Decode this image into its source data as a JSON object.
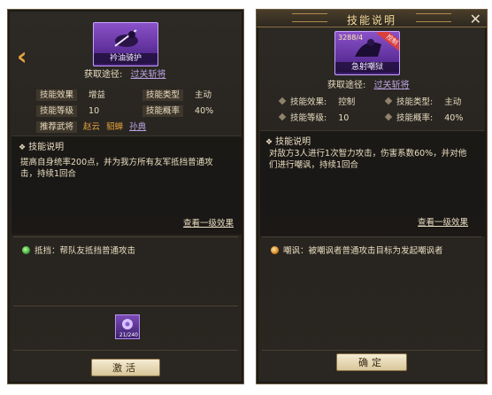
{
  "left": {
    "skill_card": {
      "name": "衿油骑护"
    },
    "source_label": "获取途径:",
    "source_link": "过关斩将",
    "attrs": {
      "effect_label": "技能效果",
      "effect_value": "增益",
      "type_label": "技能类型",
      "type_value": "主动",
      "level_label": "技能等级",
      "level_value": "10",
      "rate_label": "技能概率",
      "rate_value": "40%",
      "rec_label": "推荐武将",
      "rec_names": [
        "赵云",
        "貂蝉",
        "孙典"
      ]
    },
    "desc": {
      "head": "技能说明",
      "text": "提高自身统率200点，并为我方所有友军抵挡普通攻击，持续1回合",
      "more": "查看一级效果"
    },
    "effect": "抵挡：帮队友抵挡普通攻击",
    "item_qty": "21/240",
    "button": "激活"
  },
  "right": {
    "title": "技能说明",
    "skill_card": {
      "name": "急射嘲狱",
      "level": "3288/4",
      "badge": "控制"
    },
    "source_label": "获取途径:",
    "source_link": "过关斩将",
    "attrs": {
      "effect_label": "技能效果:",
      "effect_value": "控制",
      "type_label": "技能类型:",
      "type_value": "主动",
      "level_label": "技能等级:",
      "level_value": "10",
      "rate_label": "技能概率:",
      "rate_value": "40%"
    },
    "desc": {
      "head": "技能说明",
      "text": "对敌方3人进行1次智力攻击，伤害系数60%，并对他们进行嘲讽，持续1回合",
      "more": "查看一级效果"
    },
    "effect": "嘲讽：被嘲讽者普通攻击目标为发起嘲讽者",
    "button": "确定"
  },
  "colors": {
    "gold": "#d6b56d",
    "orange": "#e8a23d",
    "purple_link": "#b9a3e3",
    "panel_bg": "#2a2621"
  },
  "icons": [
    "back-arrow-icon",
    "close-icon",
    "diamond-icon",
    "green-gem-icon",
    "orange-gem-icon"
  ]
}
